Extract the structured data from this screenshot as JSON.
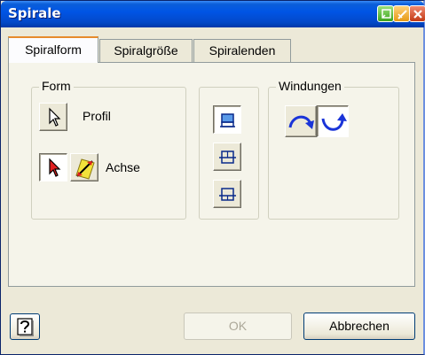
{
  "window": {
    "title": "Spirale"
  },
  "tabs": [
    {
      "label": "Spiralform",
      "active": true
    },
    {
      "label": "Spiralgröße",
      "active": false
    },
    {
      "label": "Spiralenden",
      "active": false
    }
  ],
  "form_group": {
    "label": "Form",
    "profile_label": "Profil",
    "axis_label": "Achse"
  },
  "windings_group": {
    "label": "Windungen"
  },
  "buttons": {
    "ok_label": "OK",
    "ok_enabled": false,
    "cancel_label": "Abbrechen"
  },
  "icons": {
    "profile_select": "cursor-arrow-icon",
    "axis_select": "red-cursor-arrow-icon",
    "axis_flip": "axis-flip-icon",
    "output_options": [
      "output-top-icon",
      "output-middle-icon",
      "output-bottom-icon"
    ],
    "windings": [
      "clockwise-icon",
      "counterclockwise-icon"
    ],
    "help": "help-icon"
  },
  "colors": {
    "titlebar": "#0055e5",
    "active_tab_accent": "#e68b2c",
    "dialog_bg": "#ece9d8",
    "arrow_blue": "#1a34d8"
  }
}
